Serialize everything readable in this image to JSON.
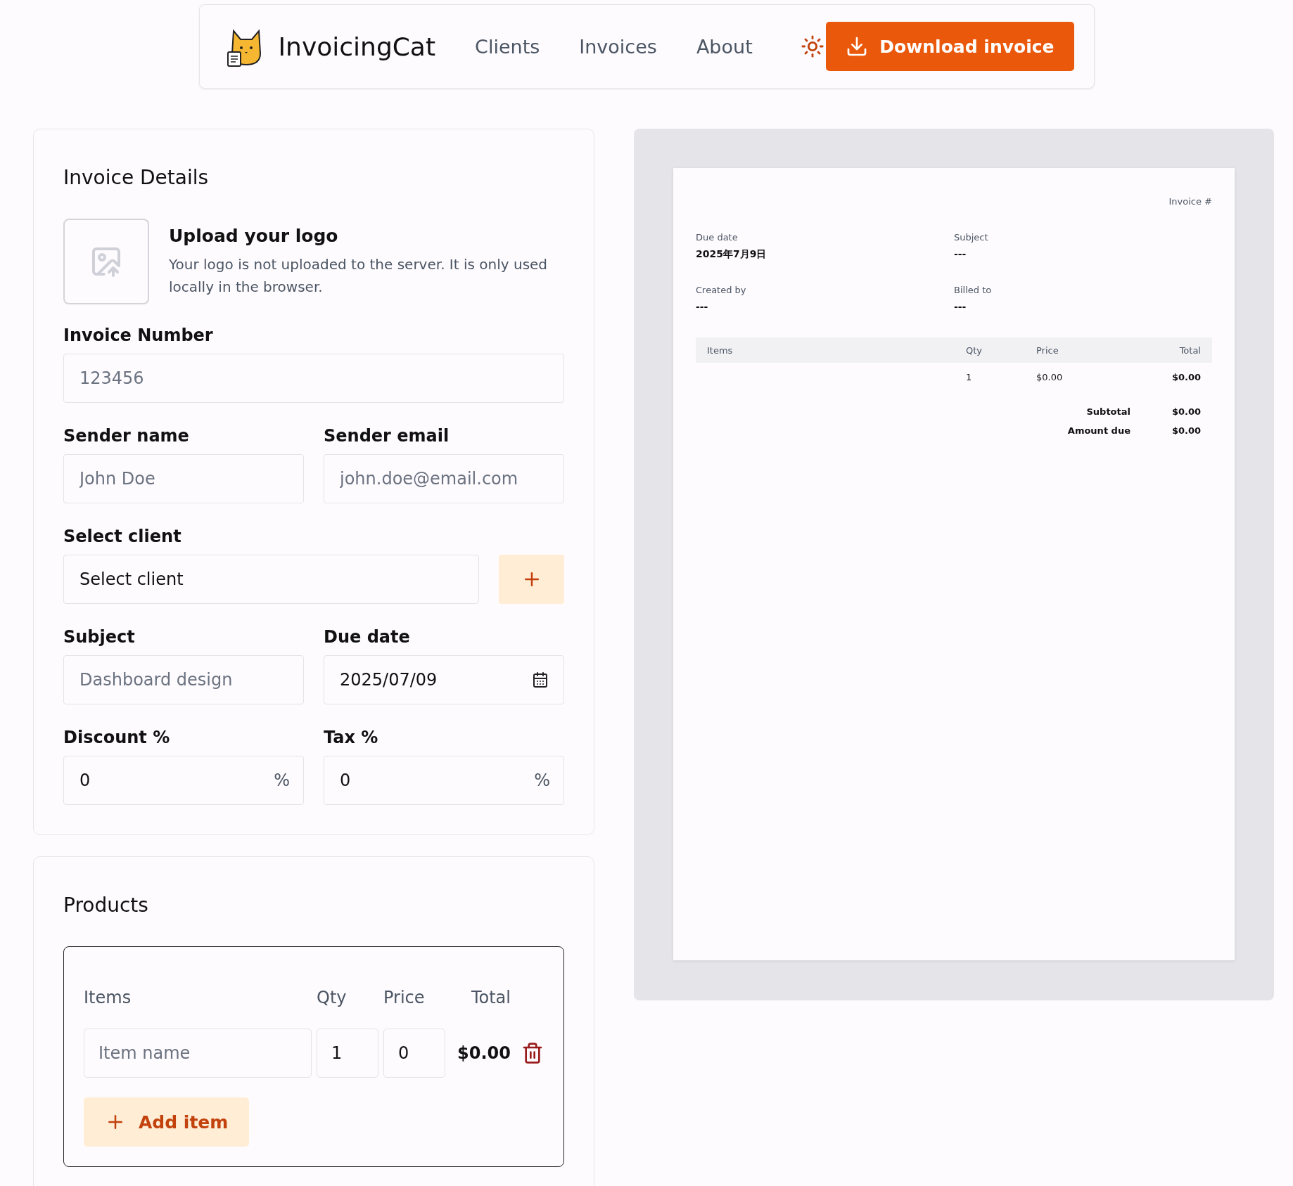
{
  "header": {
    "brand": "InvoicingCat",
    "nav": [
      {
        "label": "Clients"
      },
      {
        "label": "Invoices"
      },
      {
        "label": "About"
      }
    ],
    "download_button": "Download invoice"
  },
  "invoice_details": {
    "title": "Invoice Details",
    "logo": {
      "title": "Upload your logo",
      "description": "Your logo is not uploaded to the server. It is only used locally in the browser."
    },
    "rows": [
      [
        {
          "kind": "text",
          "label": "Invoice Number",
          "placeholder": "123456"
        }
      ],
      [
        {
          "kind": "text",
          "label": "Sender name",
          "placeholder": "John Doe"
        },
        {
          "kind": "text",
          "label": "Sender email",
          "placeholder": "john.doe@email.com"
        }
      ],
      [
        {
          "kind": "select",
          "label": "Select client",
          "value": "Select client"
        }
      ],
      [
        {
          "kind": "text",
          "label": "Subject",
          "placeholder": "Dashboard design"
        },
        {
          "kind": "date",
          "label": "Due date",
          "value": "2025/07/09"
        }
      ],
      [
        {
          "kind": "percent",
          "label": "Discount %",
          "value": "0",
          "suffix": "%"
        },
        {
          "kind": "percent",
          "label": "Tax %",
          "value": "0",
          "suffix": "%"
        }
      ]
    ]
  },
  "products": {
    "title": "Products",
    "columns": [
      "Items",
      "Qty",
      "Price",
      "Total"
    ],
    "rows": [
      {
        "item_placeholder": "Item name",
        "qty": "1",
        "price": "0",
        "total": "$0.00"
      }
    ],
    "add_button": "Add item"
  },
  "preview": {
    "invoice_label": "Invoice #",
    "fields": [
      {
        "label": "Due date",
        "value": "2025年7月9日"
      },
      {
        "label": "Subject",
        "value": "---"
      },
      {
        "label": "Created by",
        "value": "---"
      },
      {
        "label": "Billed to",
        "value": "---"
      }
    ],
    "columns": [
      "Items",
      "Qty",
      "Price",
      "Total"
    ],
    "rows": [
      {
        "qty": "1",
        "price": "$0.00",
        "total": "$0.00"
      }
    ],
    "totals": [
      {
        "label": "Subtotal",
        "value": "$0.00"
      },
      {
        "label": "Amount due",
        "value": "$0.00"
      }
    ]
  }
}
